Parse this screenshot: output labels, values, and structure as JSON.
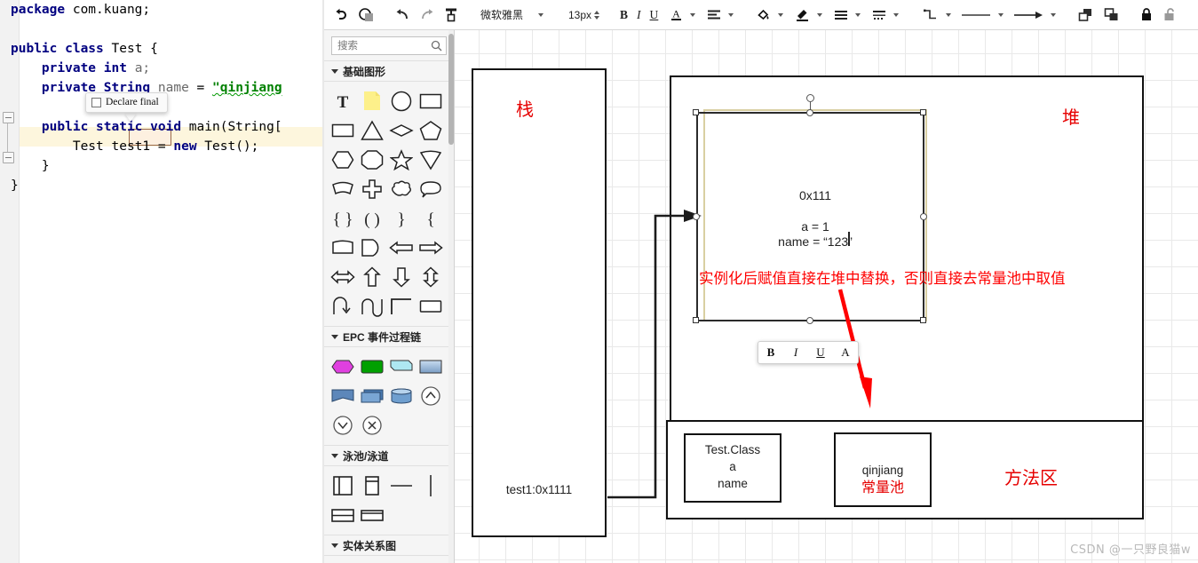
{
  "code_editor": {
    "lines": [
      [
        {
          "t": "package ",
          "c": "kw"
        },
        {
          "t": "com.kuang;",
          "c": "plain"
        }
      ],
      [],
      [
        {
          "t": "public class ",
          "c": "kw"
        },
        {
          "t": "Test {",
          "c": "plain"
        }
      ],
      [
        {
          "t": "    private int ",
          "c": "kw"
        },
        {
          "t": "a;",
          "c": "fld"
        }
      ],
      [
        {
          "t": "    private String ",
          "c": "kw"
        },
        {
          "t": "name",
          "c": "fld"
        },
        {
          "t": " = ",
          "c": "plain"
        },
        {
          "t": "\"qinjiang",
          "c": "str"
        }
      ],
      [],
      [
        {
          "t": "    public static void ",
          "c": "kw"
        },
        {
          "t": "main(String[",
          "c": "plain"
        }
      ],
      [
        {
          "t": "        Test ",
          "c": "plain"
        },
        {
          "t": "test1",
          "c": "plain"
        },
        {
          "t": " = ",
          "c": "plain"
        },
        {
          "t": "new ",
          "c": "kw"
        },
        {
          "t": "Test();",
          "c": "plain"
        }
      ],
      [
        {
          "t": "    }",
          "c": "plain"
        }
      ],
      [
        {
          "t": "}",
          "c": "plain"
        }
      ]
    ],
    "tooltip": {
      "label": "Declare final",
      "checkbox_checked": false
    },
    "selected_variable": "test1"
  },
  "toolbar": {
    "items": [
      {
        "name": "undo-arrow-icon",
        "label": ""
      },
      {
        "name": "fill-color-icon",
        "label": ""
      },
      {
        "name": "undo-icon",
        "label": ""
      },
      {
        "name": "redo-icon",
        "label": ""
      },
      {
        "name": "format-painter-icon",
        "label": ""
      }
    ],
    "font_family": "微软雅黑",
    "font_size": "13px",
    "bold_label": "B",
    "italic_label": "I",
    "underline_label": "U",
    "font_color_label": "A",
    "align_label": "",
    "fill_label": "",
    "line_color_label": "",
    "lock_label": "",
    "unlock_label": "",
    "link_label": ""
  },
  "shape_panel": {
    "search": {
      "placeholder": "搜索",
      "value": ""
    },
    "sections": [
      {
        "title": "基础图形"
      },
      {
        "title": "EPC 事件过程链"
      },
      {
        "title": "泳池/泳道"
      },
      {
        "title": "实体关系图"
      }
    ]
  },
  "canvas": {
    "stack_label": "栈",
    "stack_content": "test1:0x1111",
    "heap_label": "堆",
    "heap_address": "0x111",
    "heap_field_a": "a = 1",
    "heap_field_name": "name =  “123”",
    "red_note": "实例化后赋值直接在堆中替换，否则直接去常量池中取值",
    "method_area_label": "方法区",
    "class_box_text": "Test.Class\na\nname",
    "constant_pool_value": "qinjiang",
    "constant_pool_label": "常量池",
    "format_buttons": [
      "B",
      "I",
      "U",
      "A"
    ]
  },
  "watermark": "CSDN @一只野良猫w",
  "colors": {
    "red": "#e60000",
    "note_red": "#ff0000",
    "selection": "#d9cfa2",
    "highlight_line": "#fdf6dd",
    "keyword": "#000080",
    "string": "#008000"
  }
}
